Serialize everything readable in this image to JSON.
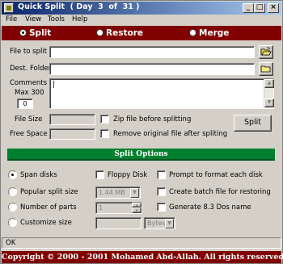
{
  "window": {
    "title": "Quick Split  ( Day  3  of  31 )",
    "minimize_glyph": "_",
    "maximize_glyph": "□",
    "close_glyph": "×"
  },
  "menu": [
    "File",
    "View",
    "Tools",
    "Help"
  ],
  "modes": [
    {
      "label": "Split",
      "selected": true
    },
    {
      "label": "Restore",
      "selected": false
    },
    {
      "label": "Merge",
      "selected": false
    }
  ],
  "form": {
    "file_to_split_label": "File to split",
    "file_to_split_value": "",
    "dest_folder_label": "Dest. Folder",
    "dest_folder_value": "",
    "comments_label": "Comments",
    "max_label": "Max 300",
    "comment_count": "0",
    "comments_value": "",
    "file_size_label": "File Size",
    "file_size_value": "",
    "free_space_label": "Free Space",
    "free_space_value": "",
    "zip_label": "Zip file before splitting",
    "remove_label": "Remove original file after spliting",
    "split_button": "Split"
  },
  "split_options": {
    "header": "Split Options",
    "span_disks": "Span disks",
    "popular_size": "Popular split size",
    "popular_size_value": "1.44 MB",
    "number_of_parts": "Number of parts",
    "parts_value": "1",
    "customize_size": "Customize size",
    "custom_size_value": "",
    "custom_unit": "Bytes",
    "floppy_disk": "Floppy Disk",
    "prompt_format": "Prompt to format each disk",
    "create_batch": "Create batch file for restoring",
    "generate_dos": "Generate 8.3 Dos name"
  },
  "status": "OK",
  "copyright": "Copyright © 2000 - 2001 Mohamed Abd-Allah. All rights reserved.",
  "colors": {
    "mode_bar": "#800000",
    "options_bar": "#007f2e",
    "title_gradient_start": "#0a246a"
  }
}
